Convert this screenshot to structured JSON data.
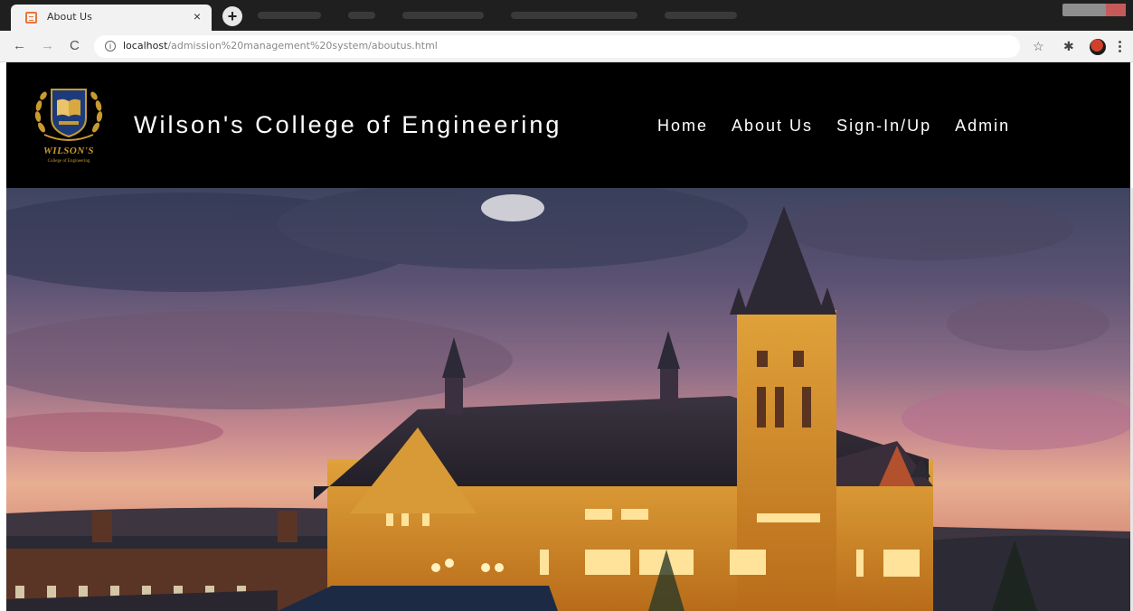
{
  "browser": {
    "tab_title": "About Us",
    "tab_close": "×",
    "new_tab": "+",
    "url_host": "localhost",
    "url_path": "/admission%20management%20system/aboutus.html",
    "icons": [
      "back-arrow-icon",
      "forward-arrow-icon",
      "reload-icon",
      "info-icon",
      "star-icon",
      "puzzle-icon",
      "kebab-menu-icon"
    ]
  },
  "header": {
    "title": "Wilson's College of Engineering",
    "logo": {
      "name": "WILSON'S",
      "subtitle": "College of Engineering"
    },
    "nav": [
      {
        "label": "Home"
      },
      {
        "label": "About Us"
      },
      {
        "label": "Sign-In/Up"
      },
      {
        "label": "Admin"
      }
    ]
  },
  "colors": {
    "header_bg": "#000000",
    "nav_text": "#ffffff",
    "logo_gold": "#c99a2e",
    "logo_blue": "#1d3b7a"
  },
  "hero": {
    "description_icon": "college-building-image"
  }
}
